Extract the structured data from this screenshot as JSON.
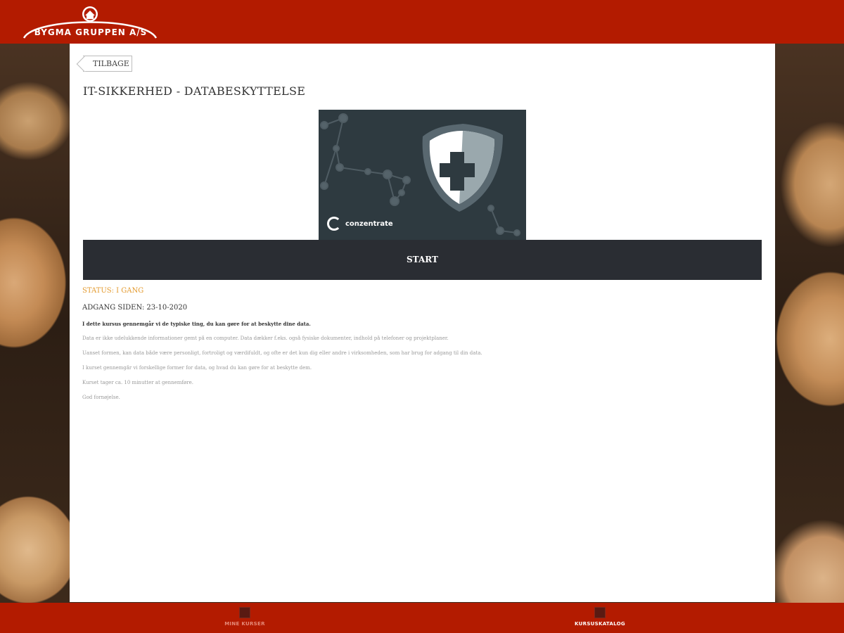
{
  "header": {
    "brand": "BYGMA GRUPPEN A/S"
  },
  "toolbar": {
    "back_label": "TILBAGE"
  },
  "course": {
    "title": "IT-SIKKERHED - DATABESKYTTELSE",
    "image_brand": "conzentrate",
    "start_label": "START",
    "status": "STATUS: I GANG",
    "access": "ADGANG SIDEN: 23-10-2020",
    "description": [
      "I dette kursus gennemgår vi de typiske ting, du kan gøre for at beskytte dine data.",
      "Data er ikke udelukkende informationer gemt på en computer. Data dækker f.eks. også fysiske dokumenter, indhold på telefoner og projektplaner.",
      "Uanset formen, kan data både være personligt, fortroligt og værdifuldt, og ofte er det kun dig eller andre i virksomheden, som har brug for adgang til din data.",
      "I kurset gennemgår vi forskellige former for data, og hvad du kan gøre for at beskytte dem.",
      "Kurset tager ca. 10 minutter at gennemføre.",
      "God fornøjelse."
    ]
  },
  "footer": {
    "items": [
      {
        "label": "MINE KURSER",
        "icon": "home-icon",
        "active": false
      },
      {
        "label": "KURSUSKATALOG",
        "icon": "catalog-icon",
        "active": true
      }
    ]
  },
  "colors": {
    "brand_red": "#b31b00",
    "button_dark": "#2a2d33",
    "status_orange": "#e39a2e",
    "image_bg": "#2e3a40"
  }
}
